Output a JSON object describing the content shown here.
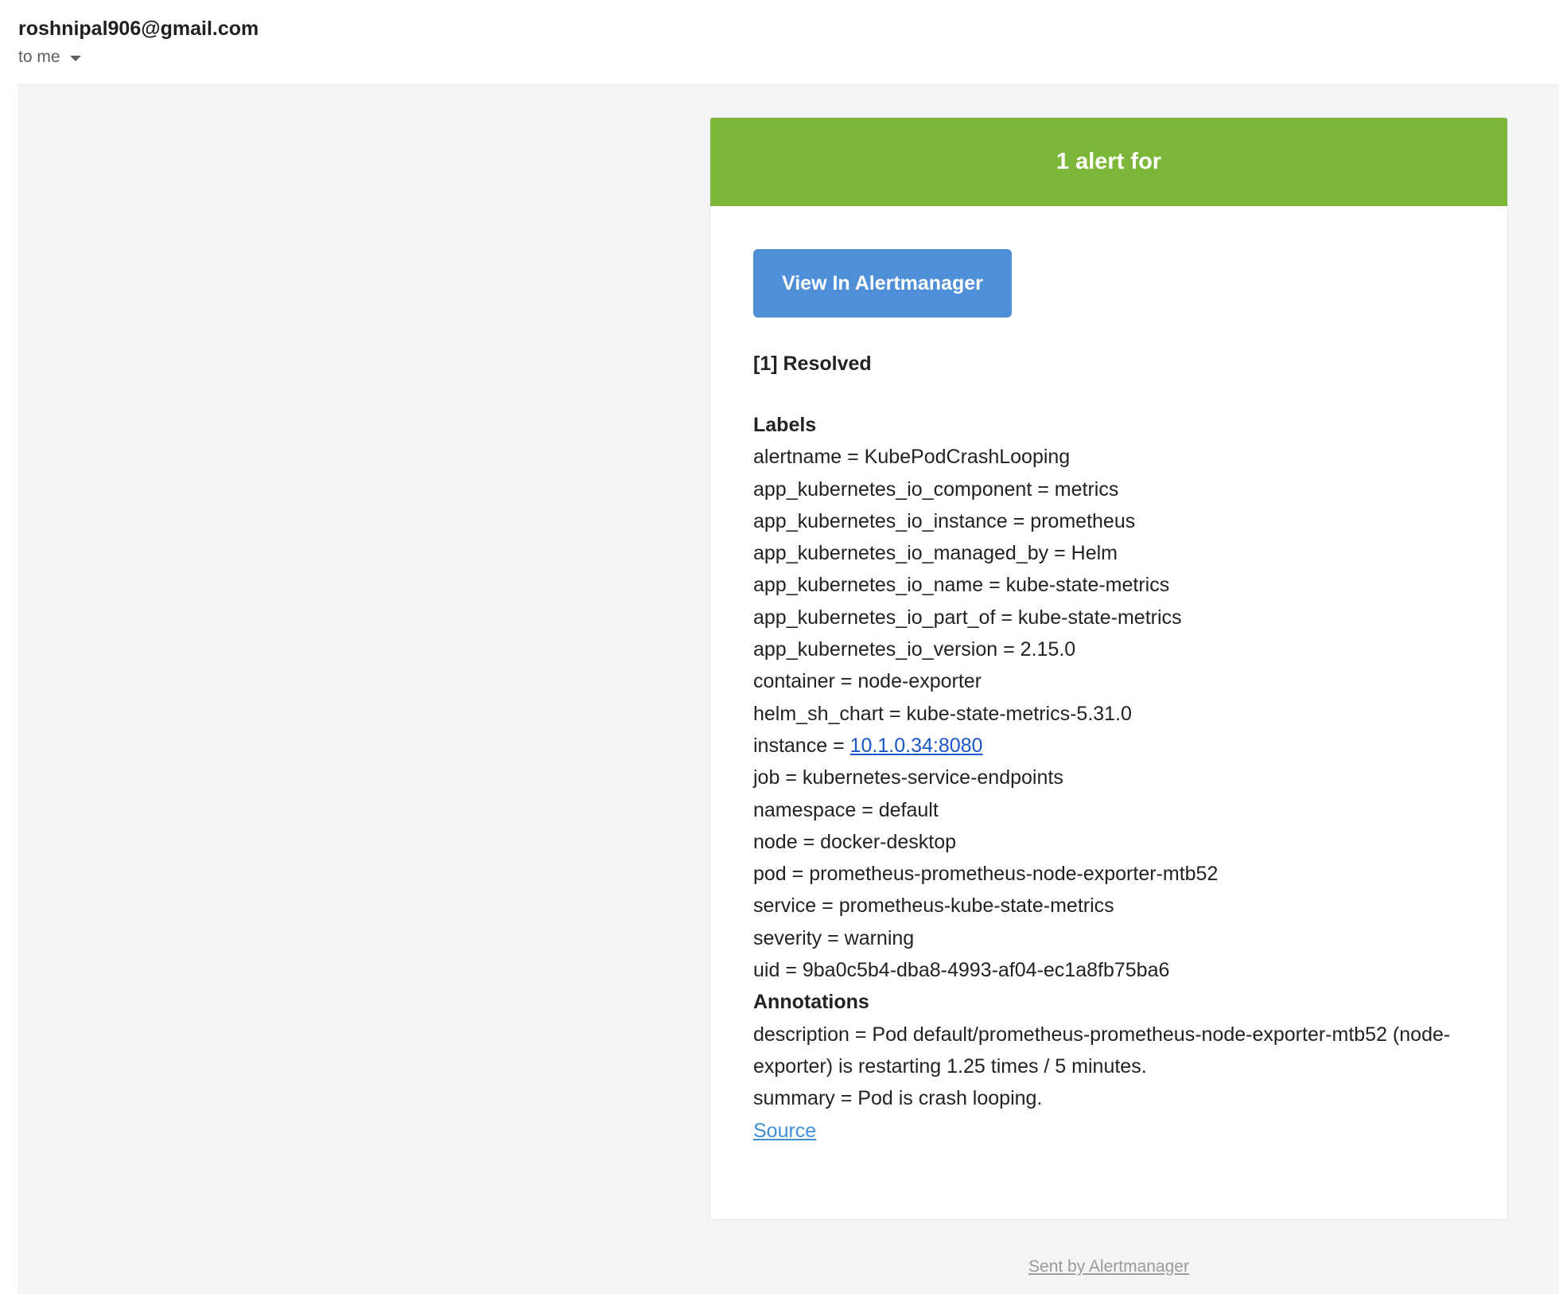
{
  "email": {
    "sender": "roshnipal906@gmail.com",
    "recipient": "to me"
  },
  "alert": {
    "banner_title": "1 alert for",
    "button_label": "View In Alertmanager",
    "status": "[1] Resolved",
    "labels_heading": "Labels",
    "labels": [
      {
        "key": "alertname",
        "value": "KubePodCrashLooping"
      },
      {
        "key": "app_kubernetes_io_component",
        "value": "metrics"
      },
      {
        "key": "app_kubernetes_io_instance",
        "value": "prometheus"
      },
      {
        "key": "app_kubernetes_io_managed_by",
        "value": "Helm"
      },
      {
        "key": "app_kubernetes_io_name",
        "value": "kube-state-metrics"
      },
      {
        "key": "app_kubernetes_io_part_of",
        "value": "kube-state-metrics"
      },
      {
        "key": "app_kubernetes_io_version",
        "value": "2.15.0"
      },
      {
        "key": "container",
        "value": "node-exporter"
      },
      {
        "key": "helm_sh_chart",
        "value": "kube-state-metrics-5.31.0"
      },
      {
        "key": "instance",
        "value": "10.1.0.34:8080"
      },
      {
        "key": "job",
        "value": "kubernetes-service-endpoints"
      },
      {
        "key": "namespace",
        "value": "default"
      },
      {
        "key": "node",
        "value": "docker-desktop"
      },
      {
        "key": "pod",
        "value": "prometheus-prometheus-node-exporter-mtb52"
      },
      {
        "key": "service",
        "value": "prometheus-kube-state-metrics"
      },
      {
        "key": "severity",
        "value": "warning"
      },
      {
        "key": "uid",
        "value": "9ba0c5b4-dba8-4993-af04-ec1a8fb75ba6"
      }
    ],
    "annotations_heading": "Annotations",
    "annotations": [
      {
        "key": "description",
        "value": "Pod default/prometheus-prometheus-node-exporter-mtb52 (node-exporter) is restarting 1.25 times / 5 minutes."
      },
      {
        "key": "summary",
        "value": "Pod is crash looping."
      }
    ],
    "source_label": "Source"
  },
  "footer": {
    "text": "Sent by Alertmanager"
  },
  "colors": {
    "banner": "#7cb73a",
    "button": "#4f8fd7",
    "link": "#1a56c7",
    "source_link": "#3f8fd8",
    "body_background": "#f4f4f4"
  },
  "icons": {
    "recipient_toggle": "chevron-down-icon"
  }
}
